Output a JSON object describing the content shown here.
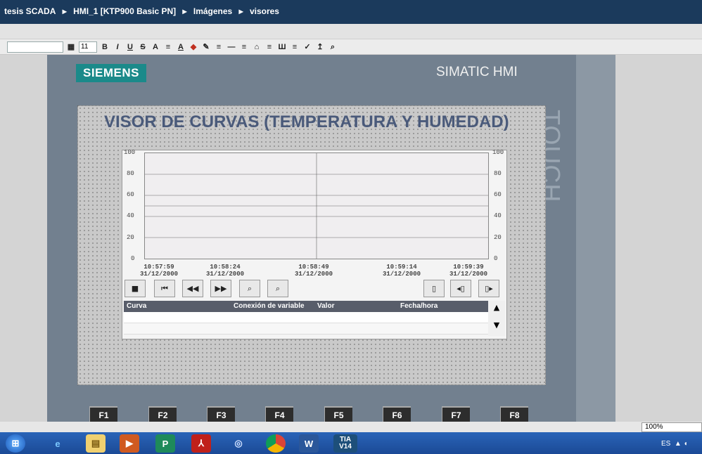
{
  "breadcrumb": [
    "tesis SCADA",
    "HMI_1 [KTP900 Basic PN]",
    "Imágenes",
    "visores"
  ],
  "breadcrumb_sep": "▸",
  "toolbar": {
    "font_size": "11",
    "buttons": [
      "B",
      "I",
      "U",
      "S",
      "A",
      "≡",
      "A",
      "◆",
      "✎",
      "≡",
      "—",
      "≡",
      "⌂",
      "≡",
      "Ш",
      "≡",
      "✓",
      "↥",
      "⌕"
    ]
  },
  "device": {
    "brand": "SIEMENS",
    "model": "SIMATIC HMI",
    "touch": "TOUCH"
  },
  "screen": {
    "title": "VISOR DE CURVAS (TEMPERATURA Y HUMEDAD)"
  },
  "trend": {
    "y_ticks": [
      "100",
      "80",
      "60",
      "40",
      "20",
      "0"
    ],
    "x_ticks": [
      {
        "time": "10:57:59",
        "date": "31/12/2000"
      },
      {
        "time": "10:58:24",
        "date": "31/12/2000"
      },
      {
        "time": "10:58:49",
        "date": "31/12/2000"
      },
      {
        "time": "10:59:14",
        "date": "31/12/2000"
      },
      {
        "time": "10:59:39",
        "date": "31/12/2000"
      }
    ]
  },
  "table": {
    "columns": [
      "Curva",
      "Conexión de variable",
      "Valor",
      "Fecha/hora"
    ]
  },
  "fkeys": [
    "F1",
    "F2",
    "F3",
    "F4",
    "F5",
    "F6",
    "F7",
    "F8"
  ],
  "status": {
    "zoom": "100%",
    "lang": "ES"
  },
  "taskbar": {
    "tia_label": "TIA V14",
    "word_label": "W",
    "publisher_label": "P"
  }
}
